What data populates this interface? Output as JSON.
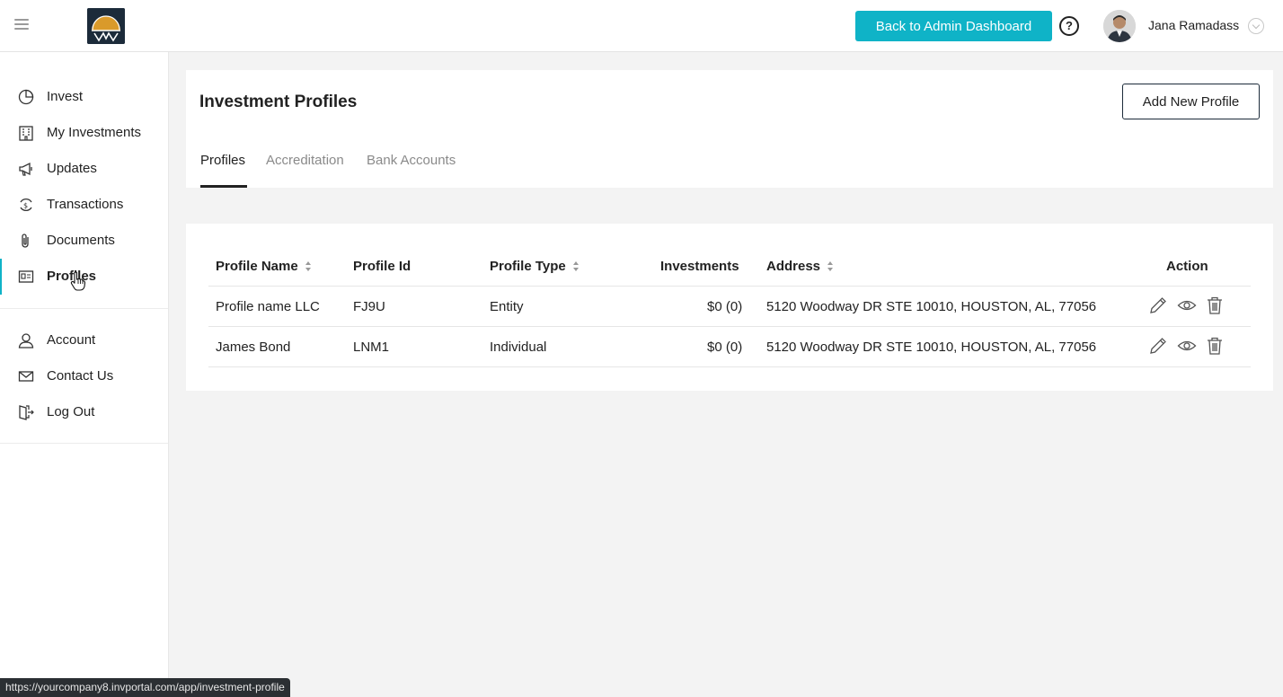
{
  "header": {
    "admin_button": "Back to Admin Dashboard",
    "help_symbol": "?",
    "user_name": "Jana Ramadass"
  },
  "sidebar": {
    "items": [
      {
        "label": "Invest",
        "icon": "pie-chart-icon"
      },
      {
        "label": "My Investments",
        "icon": "building-icon"
      },
      {
        "label": "Updates",
        "icon": "megaphone-icon"
      },
      {
        "label": "Transactions",
        "icon": "dollar-cycle-icon"
      },
      {
        "label": "Documents",
        "icon": "paperclip-icon"
      },
      {
        "label": "Profiles",
        "icon": "id-card-icon"
      },
      {
        "label": "Account",
        "icon": "user-icon"
      },
      {
        "label": "Contact Us",
        "icon": "envelope-icon"
      },
      {
        "label": "Log Out",
        "icon": "logout-icon"
      }
    ],
    "active": "Profiles"
  },
  "main": {
    "title": "Investment Profiles",
    "add_button": "Add New Profile",
    "tabs": [
      {
        "label": "Profiles",
        "active": true
      },
      {
        "label": "Accreditation",
        "active": false
      },
      {
        "label": "Bank Accounts",
        "active": false
      }
    ],
    "table": {
      "columns": [
        "Profile Name",
        "Profile Id",
        "Profile Type",
        "Investments",
        "Address",
        "Action"
      ],
      "rows": [
        {
          "name": "Profile name LLC",
          "id": "FJ9U",
          "type": "Entity",
          "investments": "$0 (0)",
          "address": "5120 Woodway DR STE 10010, HOUSTON, AL, 77056"
        },
        {
          "name": "James Bond",
          "id": "LNM1",
          "type": "Individual",
          "investments": "$0 (0)",
          "address": "5120 Woodway DR STE 10010, HOUSTON, AL, 77056"
        }
      ]
    }
  },
  "status_url": "https://yourcompany8.invportal.com/app/investment-profile",
  "colors": {
    "accent": "#0fb3c7",
    "navy": "#1c2b3a",
    "gold": "#d99a2b"
  }
}
